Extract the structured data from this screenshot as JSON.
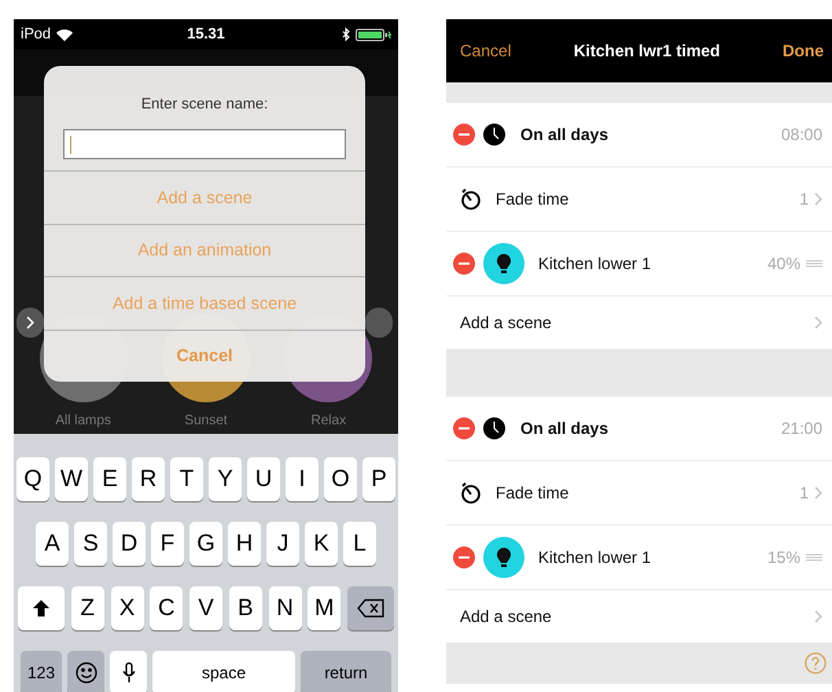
{
  "left_phone": {
    "status_bar": {
      "carrier": "iPod",
      "time": "15.31"
    },
    "scenes": [
      {
        "label": "All lamps",
        "color": "#6e6e6e"
      },
      {
        "label": "Sunset",
        "color": "#b88a35"
      },
      {
        "label": "Relax",
        "color": "#7a5488"
      }
    ],
    "dialog": {
      "title": "Enter scene name:",
      "input": {
        "focused": true
      },
      "actions": [
        {
          "label": "Add a scene",
          "kind": "option"
        },
        {
          "label": "Add an animation",
          "kind": "option"
        },
        {
          "label": "Add a time based scene",
          "kind": "option"
        },
        {
          "label": "Cancel",
          "kind": "cancel"
        }
      ]
    },
    "keyboard": {
      "rows": [
        [
          {
            "kind": "letter",
            "label": "Q"
          },
          {
            "kind": "letter",
            "label": "W"
          },
          {
            "kind": "letter",
            "label": "E"
          },
          {
            "kind": "letter",
            "label": "R"
          },
          {
            "kind": "letter",
            "label": "T"
          },
          {
            "kind": "letter",
            "label": "Y"
          },
          {
            "kind": "letter",
            "label": "U"
          },
          {
            "kind": "letter",
            "label": "I"
          },
          {
            "kind": "letter",
            "label": "O"
          },
          {
            "kind": "letter",
            "label": "P"
          }
        ],
        [
          {
            "kind": "letter",
            "label": "A"
          },
          {
            "kind": "letter",
            "label": "S"
          },
          {
            "kind": "letter",
            "label": "D"
          },
          {
            "kind": "letter",
            "label": "F"
          },
          {
            "kind": "letter",
            "label": "G"
          },
          {
            "kind": "letter",
            "label": "H"
          },
          {
            "kind": "letter",
            "label": "J"
          },
          {
            "kind": "letter",
            "label": "K"
          },
          {
            "kind": "letter",
            "label": "L"
          }
        ],
        [
          {
            "kind": "shift"
          },
          {
            "kind": "letter",
            "label": "Z"
          },
          {
            "kind": "letter",
            "label": "X"
          },
          {
            "kind": "letter",
            "label": "C"
          },
          {
            "kind": "letter",
            "label": "V"
          },
          {
            "kind": "letter",
            "label": "B"
          },
          {
            "kind": "letter",
            "label": "N"
          },
          {
            "kind": "letter",
            "label": "M"
          },
          {
            "kind": "delete"
          }
        ]
      ],
      "bottom_bar": [
        {
          "kind": "mode",
          "label": "123"
        },
        {
          "kind": "emoji"
        },
        {
          "kind": "mic"
        },
        {
          "kind": "space",
          "label": "space"
        },
        {
          "kind": "return",
          "label": "return"
        }
      ]
    }
  },
  "right_phone": {
    "nav_bar": {
      "cancel": "Cancel",
      "title": "Kitchen lwr1 timed",
      "done": "Done"
    },
    "sections": [
      {
        "rows": [
          {
            "kind": "time",
            "label": "On all days",
            "value": "08:00"
          },
          {
            "kind": "fade",
            "label": "Fade time",
            "value": "1"
          },
          {
            "kind": "lamp",
            "label": "Kitchen lower 1",
            "value": "40%"
          },
          {
            "kind": "add",
            "label": "Add a scene"
          }
        ]
      },
      {
        "rows": [
          {
            "kind": "time",
            "label": "On all days",
            "value": "21:00"
          },
          {
            "kind": "fade",
            "label": "Fade time",
            "value": "1"
          },
          {
            "kind": "lamp",
            "label": "Kitchen lower 1",
            "value": "15%"
          },
          {
            "kind": "add",
            "label": "Add a scene"
          }
        ]
      }
    ]
  }
}
